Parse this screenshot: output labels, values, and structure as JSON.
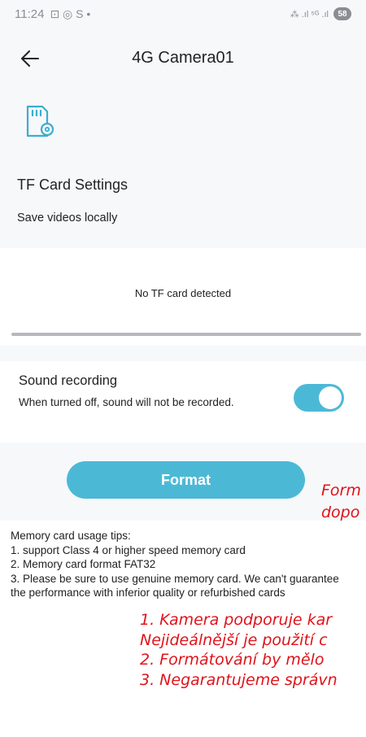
{
  "status_bar": {
    "time": "11:24",
    "left_icons_text": "⊡ ◎ S •",
    "right_icons_text": "⁂ .ıl ⁵ᴳ .ıl",
    "battery": "58"
  },
  "header": {
    "title": "4G Camera01"
  },
  "tf_card": {
    "title": "TF Card Settings",
    "subtitle": "Save videos locally",
    "status_message": "No TF card detected"
  },
  "sound_recording": {
    "title": "Sound recording",
    "description": "When turned off, sound will not be recorded.",
    "enabled": true
  },
  "actions": {
    "format_label": "Format"
  },
  "tips": {
    "heading": "Memory card usage tips:",
    "items": [
      "1. support Class 4 or higher speed memory card",
      "2. Memory card format FAT32",
      "3. Please be sure to use genuine memory card. We can't guarantee the performance with inferior quality or refurbished cards"
    ]
  },
  "annotations": {
    "format_note_line1": "Form",
    "format_note_line2": "dopo",
    "tips_note_lines": [
      "1. Kamera podporuje kar",
      "Nejideálnější je použití c",
      "2. Formátování by mělo",
      "3. Negarantujeme správn"
    ]
  },
  "colors": {
    "accent": "#4bb9d6",
    "annotation_red": "#e0131a"
  }
}
